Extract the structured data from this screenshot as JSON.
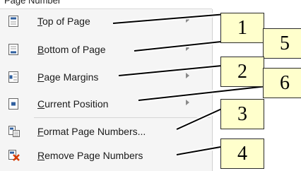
{
  "header": {
    "text": "Page Number"
  },
  "menu": {
    "items": [
      {
        "name": "menu-item-top-of-page",
        "icon": "page-top-icon",
        "accel": "T",
        "rest": "op of Page",
        "has_submenu": true
      },
      {
        "name": "menu-item-bottom-of-page",
        "icon": "page-bottom-icon",
        "accel": "B",
        "rest": "ottom of Page",
        "has_submenu": true
      },
      {
        "name": "menu-item-page-margins",
        "icon": "page-margins-icon",
        "accel": "P",
        "rest": "age Margins",
        "has_submenu": true
      },
      {
        "name": "menu-item-current-position",
        "icon": "current-position-icon",
        "accel": "C",
        "rest": "urrent Position",
        "has_submenu": true
      },
      {
        "name": "menu-item-format-page-numbers",
        "icon": "format-page-numbers-icon",
        "accel": "F",
        "rest": "ormat Page Numbers...",
        "has_submenu": false
      },
      {
        "name": "menu-item-remove-page-numbers",
        "icon": "remove-page-numbers-icon",
        "accel": "R",
        "rest": "emove Page Numbers",
        "has_submenu": false
      }
    ]
  },
  "callouts": [
    {
      "label": "1"
    },
    {
      "label": "5"
    },
    {
      "label": "2"
    },
    {
      "label": "6"
    },
    {
      "label": "3"
    },
    {
      "label": "4"
    }
  ],
  "colors": {
    "callout_fill": "#ffffcc",
    "menu_bg": "#f5f5f5",
    "remove_icon_red": "#d83b01"
  }
}
